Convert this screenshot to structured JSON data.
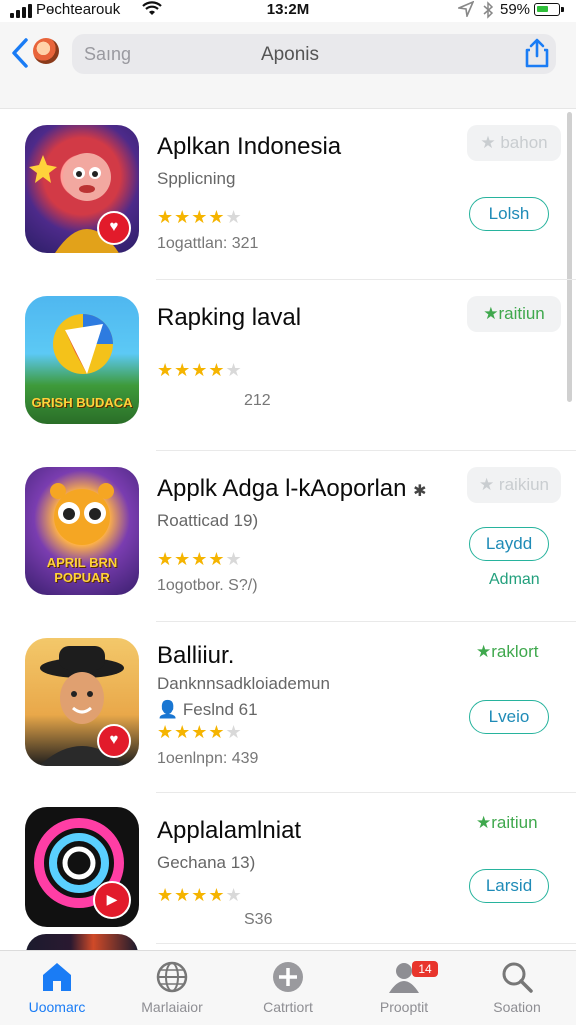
{
  "status": {
    "carrier": "Pɵchtearouk",
    "time": "13:2M",
    "battery_pct": "59%",
    "battery_level": 0.59
  },
  "nav": {
    "search_placeholder": "Saıng",
    "title": "Aponis"
  },
  "apps": [
    {
      "name": "Aplkan  Indonesia",
      "subtitle": "Spplicning",
      "rating": 4,
      "meta": "1ogattlan:  321",
      "rank": "★ bahon",
      "rank_style": "pill-muted",
      "button": "Lolsh",
      "below": ""
    },
    {
      "name": "Rapking laval",
      "subtitle": "",
      "rating": 4,
      "meta": "212",
      "rank": "★raitiun",
      "rank_style": "pill-green",
      "button": "",
      "below": ""
    },
    {
      "name": "Applk Adga l‑kAoporlan",
      "subtitle": "Roatticad 19)",
      "rating": 4,
      "meta": "1ogotbor.  S?/)",
      "rank": "★ raikiun",
      "rank_style": "pill-muted",
      "button": "Laydd",
      "below": "Adman"
    },
    {
      "name": "Balliiur.",
      "subtitle": "Danknnsadkloiademun",
      "subtitle2": "Feslnd  61",
      "rating": 4,
      "meta": "1oenlnpn:  439",
      "rank": "★raklort",
      "rank_style": "plain",
      "button": "Lveio",
      "below": ""
    },
    {
      "name": "Applalamlniat",
      "subtitle": "Gechana 13)",
      "rating": 4,
      "meta": "S36",
      "rank": "★raitiun",
      "rank_style": "plain",
      "button": "Larsid",
      "below": ""
    }
  ],
  "icon_words": {
    "app2": "GRISH BUDACA",
    "app3": "APRIL BRN POPUAR"
  },
  "tabs": [
    {
      "label": "Uoomarc",
      "icon": "home-icon",
      "active": true
    },
    {
      "label": "Marlaiaior",
      "icon": "globe-icon",
      "active": false
    },
    {
      "label": "Catrtiort",
      "icon": "plus-icon",
      "active": false
    },
    {
      "label": "Prooptit",
      "icon": "profile-icon",
      "active": false,
      "badge": "14"
    },
    {
      "label": "Soation",
      "icon": "search-icon",
      "active": false
    }
  ],
  "colors": {
    "accent": "#1a7cf5",
    "green": "#3fa84d",
    "star": "#f5b400",
    "button_border": "#27b39d"
  }
}
